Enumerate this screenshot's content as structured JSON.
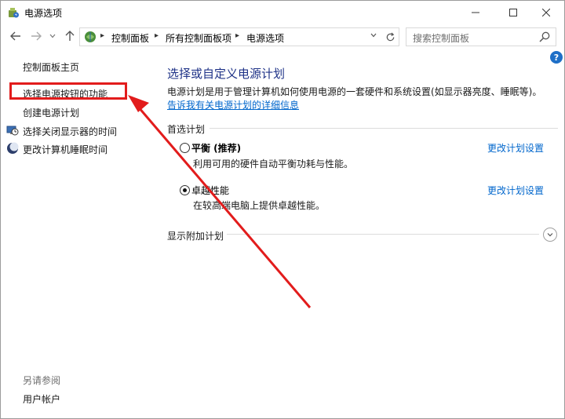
{
  "window": {
    "title": "电源选项"
  },
  "address": {
    "crumbs": [
      "控制面板",
      "所有控制面板项",
      "电源选项"
    ]
  },
  "search": {
    "placeholder": "搜索控制面板"
  },
  "sidebar": {
    "items": [
      {
        "label": "控制面板主页"
      },
      {
        "label": "选择电源按钮的功能"
      },
      {
        "label": "创建电源计划"
      },
      {
        "label": "选择关闭显示器的时间"
      },
      {
        "label": "更改计算机睡眠时间"
      }
    ],
    "see_also_label": "另请参阅",
    "see_also_items": [
      {
        "label": "用户帐户"
      }
    ]
  },
  "main": {
    "title": "选择或自定义电源计划",
    "description": "电源计划是用于管理计算机如何使用电源的一套硬件和系统设置(如显示器亮度、睡眠等)。",
    "description_link": "告诉我有关电源计划的详细信息",
    "preferred_header": "首选计划",
    "plans": [
      {
        "name": "平衡 (推荐)",
        "desc": "利用可用的硬件自动平衡功耗与性能。",
        "link": "更改计划设置",
        "selected": false
      },
      {
        "name": "卓越性能",
        "desc": "在较高端电脑上提供卓越性能。",
        "link": "更改计划设置",
        "selected": true
      }
    ],
    "additional_header": "显示附加计划"
  },
  "colors": {
    "accent_link": "#0066cc",
    "title_blue": "#1e3287",
    "annotation_red": "#e21c1c"
  }
}
